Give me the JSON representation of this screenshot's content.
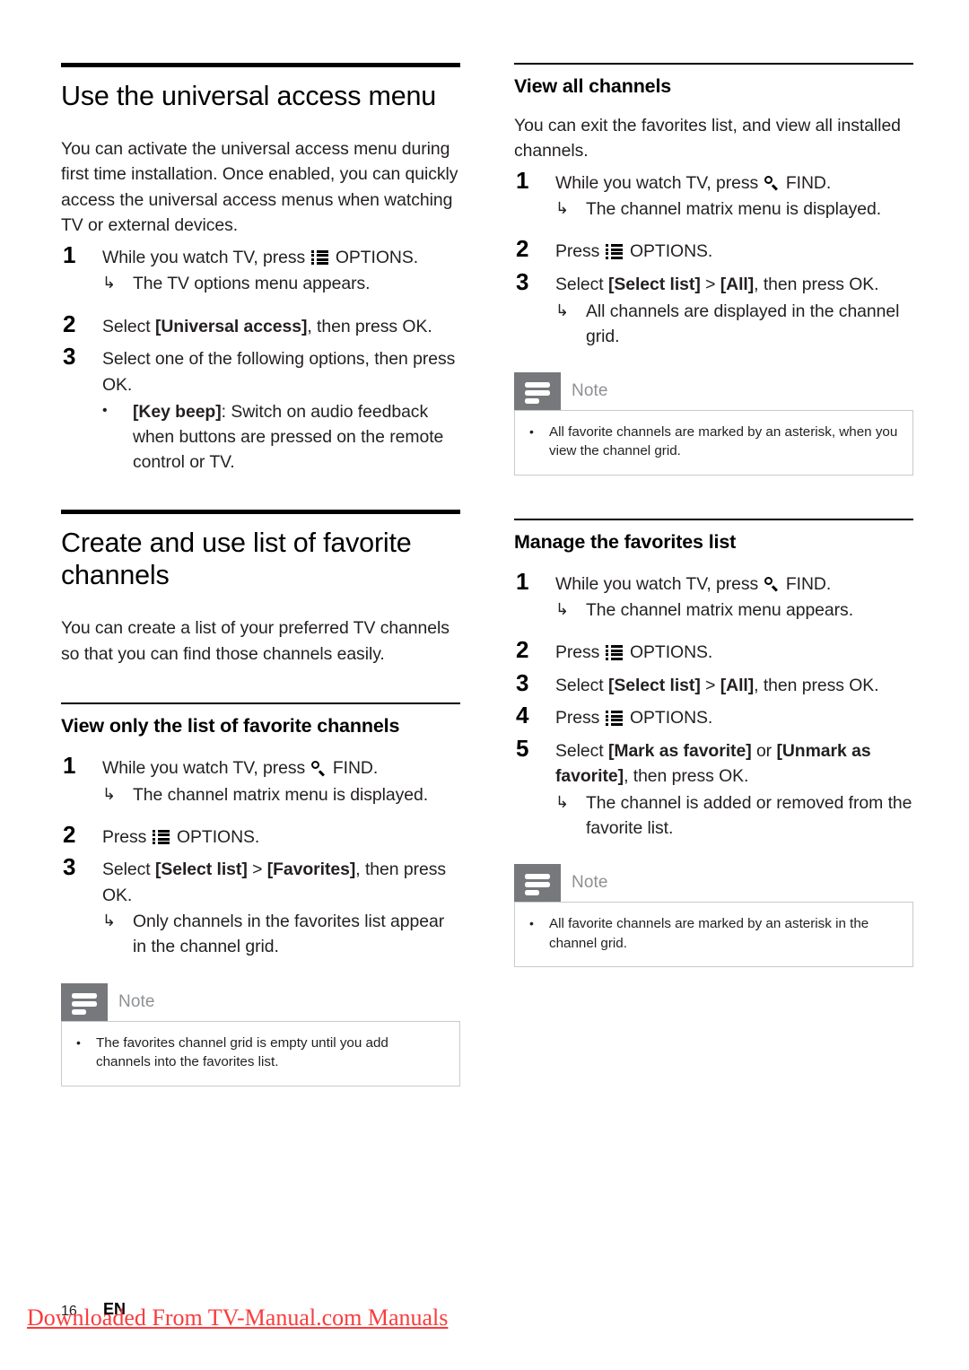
{
  "left_column": {
    "section1": {
      "title": "Use the universal access menu",
      "intro": "You can activate the universal access menu during first time installation. Once enabled, you can quickly access the universal access menus when watching TV or external devices.",
      "steps": [
        {
          "num": "1",
          "text_before": "While you watch TV, press ",
          "icon": "options-icon",
          "text_after": " OPTIONS.",
          "result": "The TV options menu appears.",
          "arrow": "↳"
        },
        {
          "num": "2",
          "text_before": "Select ",
          "bold": "[Universal access]",
          "text_after": ", then press OK."
        },
        {
          "num": "3",
          "text_before": "Select one of the following options, then press OK.",
          "bullet_dot": "•",
          "bullet_bold": "[Key beep]",
          "bullet_text": ": Switch on audio feedback when buttons are pressed on the remote control or TV."
        }
      ]
    },
    "section2": {
      "title": "Create and use list of favorite channels",
      "intro": "You can create a list of your preferred TV channels so that you can find those channels easily.",
      "sub1": {
        "title": "View only the list of favorite channels",
        "steps": [
          {
            "num": "1",
            "text_before": "While you watch TV, press ",
            "icon": "find-icon",
            "text_after": " FIND.",
            "result": "The channel matrix menu is displayed.",
            "arrow": "↳"
          },
          {
            "num": "2",
            "text_before": "Press ",
            "icon": "options-icon",
            "text_after": " OPTIONS."
          },
          {
            "num": "3",
            "text_before": "Select ",
            "bold1": "[Select list]",
            "mid": " > ",
            "bold2": "[Favorites]",
            "text_after": ", then press OK.",
            "result": "Only channels in the favorites list appear in the channel grid.",
            "arrow": "↳"
          }
        ],
        "note": {
          "label": "Note",
          "items": [
            "The favorites channel grid is empty until you add channels into the favorites list."
          ],
          "bullet": "•"
        }
      }
    }
  },
  "right_column": {
    "sub_view_all": {
      "title": "View all channels",
      "intro": "You can exit the favorites list, and view all installed channels.",
      "steps": [
        {
          "num": "1",
          "text_before": "While you watch TV, press ",
          "icon": "find-icon",
          "text_after": " FIND.",
          "result": "The channel matrix menu is displayed.",
          "arrow": "↳"
        },
        {
          "num": "2",
          "text_before": "Press ",
          "icon": "options-icon",
          "text_after": " OPTIONS."
        },
        {
          "num": "3",
          "text_before": "Select ",
          "bold1": "[Select list]",
          "mid": " > ",
          "bold2": "[All]",
          "text_after": ", then press OK.",
          "result": "All channels are displayed in the channel grid.",
          "arrow": "↳"
        }
      ],
      "note": {
        "label": "Note",
        "items": [
          "All favorite channels are marked by an asterisk, when you view the channel grid."
        ],
        "bullet": "•"
      }
    },
    "sub_manage": {
      "title": "Manage the favorites list",
      "steps": [
        {
          "num": "1",
          "text_before": "While you watch TV, press ",
          "icon": "find-icon",
          "text_after": " FIND.",
          "result": "The channel matrix menu appears.",
          "arrow": "↳"
        },
        {
          "num": "2",
          "text_before": "Press ",
          "icon": "options-icon",
          "text_after": " OPTIONS."
        },
        {
          "num": "3",
          "text_before": "Select ",
          "bold1": "[Select list]",
          "mid": " > ",
          "bold2": "[All]",
          "text_after": ", then press OK."
        },
        {
          "num": "4",
          "text_before": "Press ",
          "icon": "options-icon",
          "text_after": " OPTIONS."
        },
        {
          "num": "5",
          "text_before": "Select ",
          "bold1": "[Mark as favorite]",
          "mid": " or ",
          "bold2": "[Unmark as favorite]",
          "text_after": ", then press OK.",
          "result": "The channel is added or removed from the favorite list.",
          "arrow": "↳"
        }
      ],
      "note": {
        "label": "Note",
        "items": [
          "All favorite channels are marked by an asterisk in the channel grid."
        ],
        "bullet": "•"
      }
    }
  },
  "footer": {
    "page_number": "16",
    "language_code": "EN",
    "watermark": "Downloaded From TV-Manual.com Manuals",
    "watermark_color": "#fa3c3c"
  },
  "colors": {
    "text": "#231f20",
    "note_badge": "#77787b",
    "note_label": "#8e9093",
    "note_border": "#c8cacc"
  }
}
